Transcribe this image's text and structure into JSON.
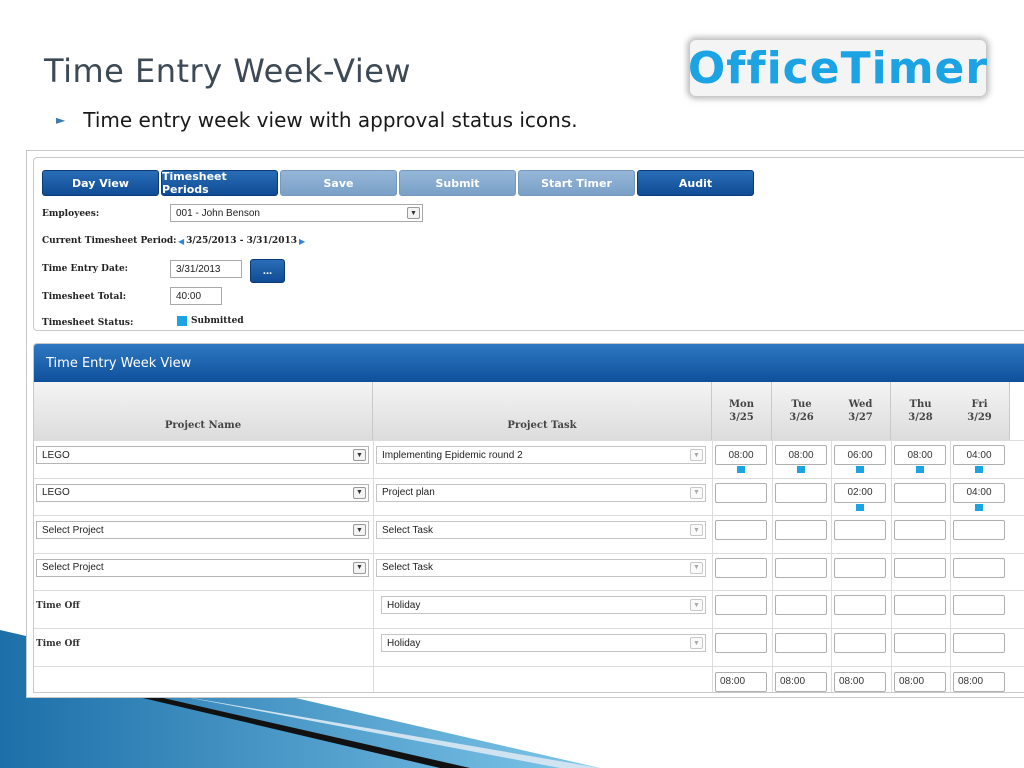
{
  "slide": {
    "title": "Time Entry Week-View",
    "logo_text": "OfficeTimer",
    "bullet": "Time entry week view with approval status icons."
  },
  "toolbar": {
    "day_view": "Day View",
    "timesheet_periods": "Timesheet Periods",
    "save": "Save",
    "submit": "Submit",
    "start_timer": "Start Timer",
    "audit": "Audit"
  },
  "form": {
    "employees_label": "Employees:",
    "employee_value": "001 - John Benson",
    "period_label": "Current Timesheet Period:",
    "period_value": "3/25/2013 - 3/31/2013",
    "entry_date_label": "Time Entry Date:",
    "entry_date_value": "3/31/2013",
    "date_picker_label": "...",
    "total_label": "Timesheet Total:",
    "total_value": "40:00",
    "status_label": "Timesheet Status:",
    "status_value": "Submitted"
  },
  "grid": {
    "title": "Time Entry Week View",
    "col_project": "Project Name",
    "col_task": "Project Task",
    "days": [
      {
        "dow": "Mon",
        "date": "3/25"
      },
      {
        "dow": "Tue",
        "date": "3/26"
      },
      {
        "dow": "Wed",
        "date": "3/27"
      },
      {
        "dow": "Thu",
        "date": "3/28"
      },
      {
        "dow": "Fri",
        "date": "3/29"
      }
    ],
    "rows": [
      {
        "project": "LEGO",
        "task": "Implementing Epidemic round 2",
        "hours": [
          "08:00",
          "08:00",
          "06:00",
          "08:00",
          "04:00"
        ]
      },
      {
        "project": "LEGO",
        "task": "Project plan",
        "hours": [
          "",
          "",
          "02:00",
          "",
          "04:00"
        ]
      },
      {
        "project": "Select Project",
        "task": "Select Task",
        "hours": [
          "",
          "",
          "",
          "",
          ""
        ]
      },
      {
        "project": "Select Project",
        "task": "Select Task",
        "hours": [
          "",
          "",
          "",
          "",
          ""
        ]
      },
      {
        "project": "Time Off",
        "task": "Holiday",
        "hours": [
          "",
          "",
          "",
          "",
          ""
        ]
      },
      {
        "project": "Time Off",
        "task": "Holiday",
        "hours": [
          "",
          "",
          "",
          "",
          ""
        ]
      }
    ],
    "totals": [
      "08:00",
      "08:00",
      "08:00",
      "08:00",
      "08:00"
    ],
    "status_color": "#1ca3e4"
  }
}
